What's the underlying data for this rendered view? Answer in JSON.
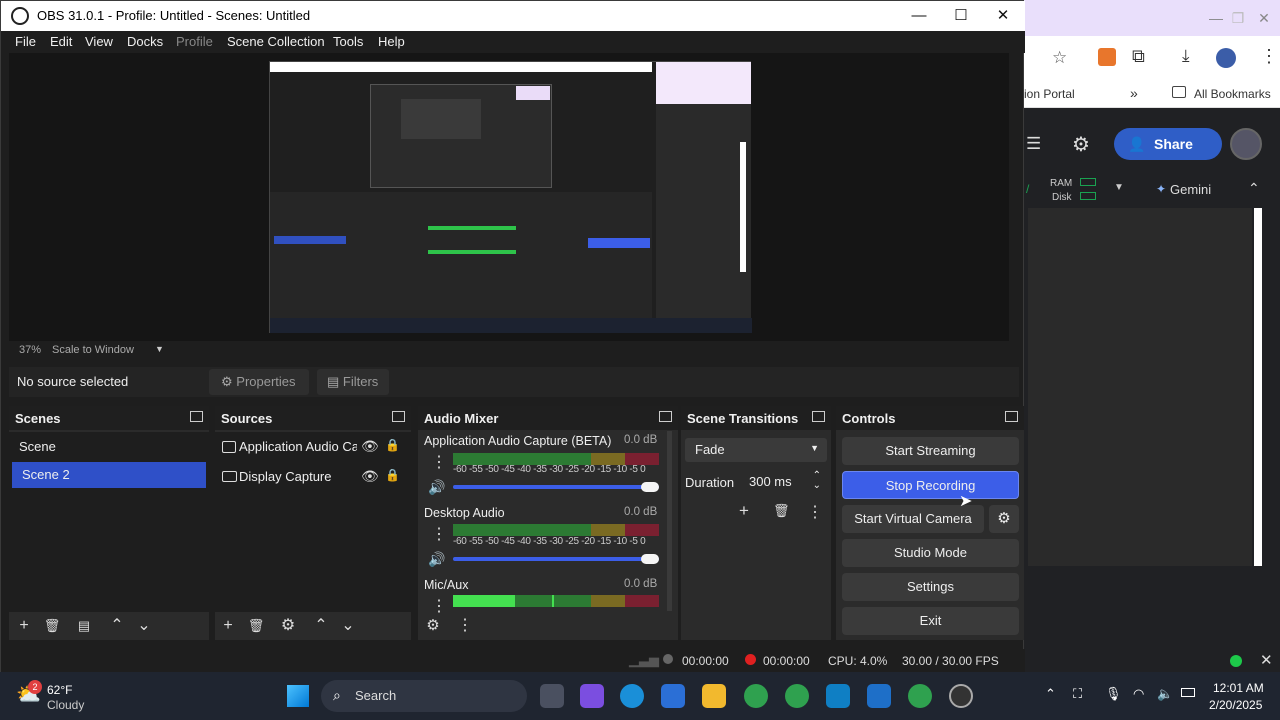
{
  "browser": {
    "bookmark_partial": "ion Portal",
    "chevron": "»",
    "all_bookmarks": "All Bookmarks",
    "share_label": "Share",
    "ram_label": "RAM",
    "disk_label": "Disk",
    "gemini_label": "Gemini"
  },
  "obs": {
    "title": "OBS 31.0.1 - Profile: Untitled - Scenes: Untitled",
    "menu": [
      "File",
      "Edit",
      "View",
      "Docks",
      "Profile",
      "Scene Collection",
      "Tools",
      "Help"
    ],
    "zoom_value": "37%",
    "zoom_mode": "Scale to Window",
    "no_source": "No source selected",
    "properties": "Properties",
    "filters": "Filters",
    "scenes": {
      "title": "Scenes",
      "items": [
        "Scene",
        "Scene 2"
      ],
      "selected": "Scene 2"
    },
    "sources": {
      "title": "Sources",
      "items": [
        "Application Audio Ca",
        "Display Capture"
      ]
    },
    "audio_mixer": {
      "title": "Audio Mixer",
      "channels": [
        {
          "name": "Application Audio Capture (BETA)",
          "db": "0.0 dB"
        },
        {
          "name": "Desktop Audio",
          "db": "0.0 dB"
        },
        {
          "name": "Mic/Aux",
          "db": "0.0 dB"
        }
      ],
      "ticks": "-60 -55 -50 -45 -40 -35 -30 -25 -20 -15 -10 -5 0"
    },
    "transitions": {
      "title": "Scene Transitions",
      "selected": "Fade",
      "duration_label": "Duration",
      "duration_value": "300 ms"
    },
    "controls": {
      "title": "Controls",
      "start_streaming": "Start Streaming",
      "stop_recording": "Stop Recording",
      "start_virtual_camera": "Start Virtual Camera",
      "studio_mode": "Studio Mode",
      "settings": "Settings",
      "exit": "Exit"
    },
    "status": {
      "stream_time": "00:00:00",
      "rec_time": "00:00:00",
      "cpu": "CPU: 4.0%",
      "fps": "30.00 / 30.00 FPS"
    }
  },
  "taskbar": {
    "weather_temp": "62°F",
    "weather_desc": "Cloudy",
    "weather_badge": "2",
    "search": "Search",
    "time": "12:01 AM",
    "date": "2/20/2025"
  },
  "colors": {
    "accent": "#3c5ee8",
    "selected": "#2f50c8",
    "record_red": "#e02020"
  }
}
